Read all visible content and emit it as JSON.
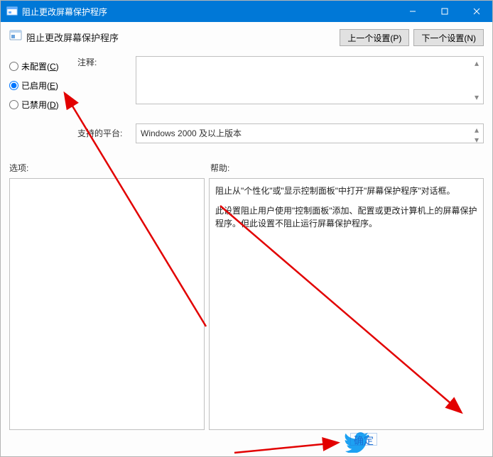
{
  "titlebar": {
    "title": "阻止更改屏幕保护程序"
  },
  "header": {
    "policy_title": "阻止更改屏幕保护程序",
    "prev_button": "上一个设置(P)",
    "next_button": "下一个设置(N)"
  },
  "radio": {
    "not_configured_prefix": "未配置(",
    "not_configured_key": "C",
    "not_configured_suffix": ")",
    "enabled_prefix": "已启用(",
    "enabled_key": "E",
    "enabled_suffix": ")",
    "disabled_prefix": "已禁用(",
    "disabled_key": "D",
    "disabled_suffix": ")",
    "selected": "enabled"
  },
  "labels": {
    "comment": "注释:",
    "supported": "支持的平台:",
    "options": "选项:",
    "help": "帮助:"
  },
  "comment_value": "",
  "supported_on": "Windows 2000 及以上版本",
  "help_text": {
    "p1": "阻止从\"个性化\"或\"显示控制面板\"中打开\"屏幕保护程序\"对话框。",
    "p2": "此设置阻止用户使用\"控制面板\"添加、配置或更改计算机上的屏幕保护程序。但此设置不阻止运行屏幕保护程序。"
  },
  "annot_button_text": "确定"
}
